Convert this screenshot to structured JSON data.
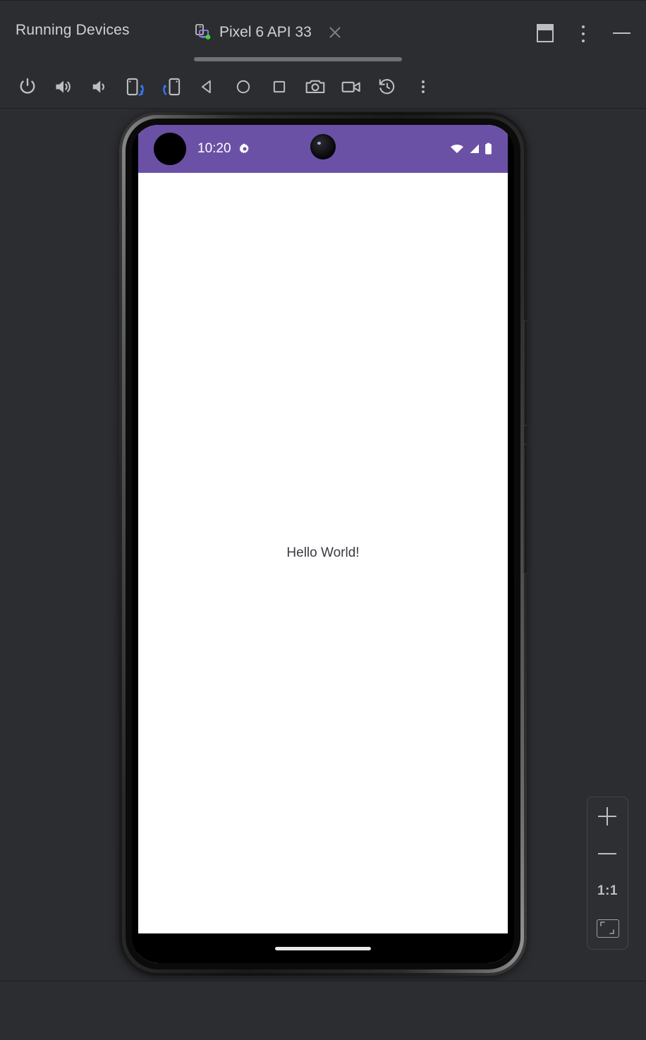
{
  "window": {
    "tool_window_title": "Running Devices",
    "controls": [
      {
        "name": "layout-button",
        "icon": "layout-icon"
      },
      {
        "name": "more-options-button",
        "icon": "kebab-menu-icon"
      },
      {
        "name": "minimize-button",
        "icon": "minimize-icon"
      }
    ]
  },
  "tab": {
    "label": "Pixel 6 API 33",
    "icon": "device-running-icon",
    "status_indicator_color": "#3BD63B",
    "close_icon": "close-icon",
    "selected": true
  },
  "toolbar": {
    "buttons": [
      {
        "name": "power-button",
        "icon": "power-icon",
        "tooltip": "Power"
      },
      {
        "name": "volume-up-button",
        "icon": "volume-up-icon",
        "tooltip": "Volume Up"
      },
      {
        "name": "volume-down-button",
        "icon": "volume-down-icon",
        "tooltip": "Volume Down"
      },
      {
        "name": "rotate-left-button",
        "icon": "rotate-left-icon",
        "tooltip": "Rotate Left"
      },
      {
        "name": "rotate-right-button",
        "icon": "rotate-right-icon",
        "tooltip": "Rotate Right"
      },
      {
        "name": "back-button",
        "icon": "back-triangle-icon",
        "tooltip": "Back"
      },
      {
        "name": "home-button",
        "icon": "home-circle-icon",
        "tooltip": "Home"
      },
      {
        "name": "overview-button",
        "icon": "overview-square-icon",
        "tooltip": "Overview"
      },
      {
        "name": "screenshot-button",
        "icon": "camera-icon",
        "tooltip": "Take Screenshot"
      },
      {
        "name": "record-button",
        "icon": "video-camera-icon",
        "tooltip": "Record Screen"
      },
      {
        "name": "snapshot-button",
        "icon": "history-rotate-icon",
        "tooltip": "Snapshots"
      },
      {
        "name": "overflow-button",
        "icon": "kebab-menu-icon",
        "tooltip": "More"
      }
    ]
  },
  "device": {
    "model": "Pixel 6",
    "statusbar": {
      "background_color": "#6A51A6",
      "clock": "10:20",
      "notification_icons": [
        "notification-dot-icon",
        "settings-gear-icon"
      ],
      "system_icons": [
        "wifi-icon",
        "cellular-signal-icon",
        "battery-icon"
      ],
      "camera_cutout": "punch-hole-camera"
    },
    "app_screen": {
      "background_color": "#FFFFFF",
      "text": "Hello World!",
      "text_color": "#3A3A42"
    },
    "navigation_bar": {
      "background_color": "#000000",
      "gesture_pill": "gesture-handle"
    },
    "hardware_buttons": [
      "power-side-button",
      "volume-rocker-side-button"
    ]
  },
  "zoom_panel": {
    "zoom_in_label": "+",
    "zoom_out_label": "−",
    "actual_size_label": "1:1",
    "fit_label": "fit-to-screen-icon"
  },
  "colors": {
    "app_background": "#2B2D30",
    "border": "#1E1F22",
    "text_primary": "#CFD1D6",
    "icon": "#BCBEC4",
    "accent_blue": "#3574F0",
    "tab_underline": "#6E7277",
    "android_purple": "#6A51A6"
  }
}
